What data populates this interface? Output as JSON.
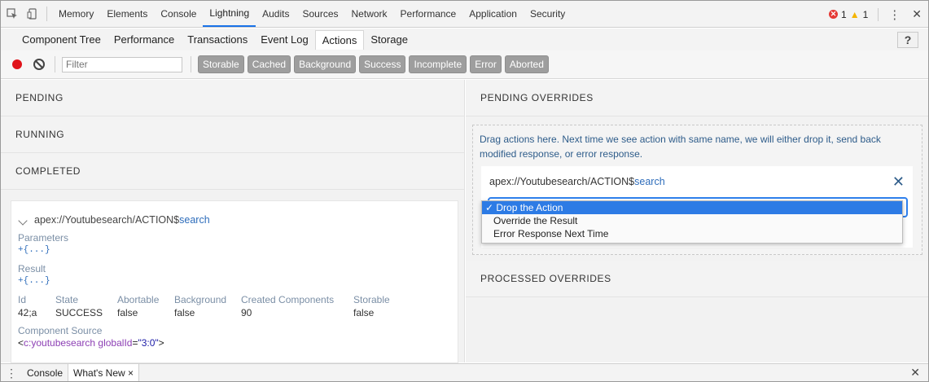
{
  "devtools": {
    "tabs": [
      "Memory",
      "Elements",
      "Console",
      "Lightning",
      "Audits",
      "Sources",
      "Network",
      "Performance",
      "Application",
      "Security"
    ],
    "active_tab": "Lightning",
    "errors": "1",
    "warnings": "1",
    "more_icon": "⋮",
    "close_icon": "✕"
  },
  "lightning": {
    "tabs": [
      "Component Tree",
      "Performance",
      "Transactions",
      "Event Log",
      "Actions",
      "Storage"
    ],
    "active_tab": "Actions",
    "help": "?"
  },
  "toolbar": {
    "filter_placeholder": "Filter",
    "pills": [
      "Storable",
      "Cached",
      "Background",
      "Success",
      "Incomplete",
      "Error",
      "Aborted"
    ]
  },
  "left": {
    "pending": "PENDING",
    "running": "RUNNING",
    "completed": "COMPLETED",
    "action": {
      "prefix": "apex://Youtubesearch/ACTION$",
      "method": "search",
      "parameters_label": "Parameters",
      "parameters_value": "+{...}",
      "result_label": "Result",
      "result_value": "+{...}",
      "fields": [
        {
          "h": "Id",
          "v": "42;a"
        },
        {
          "h": "State",
          "v": "SUCCESS"
        },
        {
          "h": "Abortable",
          "v": "false"
        },
        {
          "h": "Background",
          "v": "false"
        },
        {
          "h": "Created Components",
          "v": "90"
        },
        {
          "h": "Storable",
          "v": "false"
        }
      ],
      "component_source_label": "Component Source",
      "source_open": "<",
      "source_tag": "c:youtubesearch",
      "source_attr": " globalId",
      "source_eq": "=",
      "source_val": "\"3:0\"",
      "source_close": ">"
    }
  },
  "right": {
    "pending_overrides": "PENDING OVERRIDES",
    "hint": "Drag actions here. Next time we see action with same name, we will either drop it, send back modified response, or error response.",
    "override_prefix": "apex://Youtubesearch/ACTION$",
    "override_method": "search",
    "options": [
      "✓ Drop the Action",
      "Override the Result",
      "Error Response Next Time"
    ],
    "processed_overrides": "PROCESSED OVERRIDES"
  },
  "drawer": {
    "tabs": [
      "Console",
      "What's New"
    ],
    "active_tab": "What's New",
    "tab_close": "×"
  }
}
